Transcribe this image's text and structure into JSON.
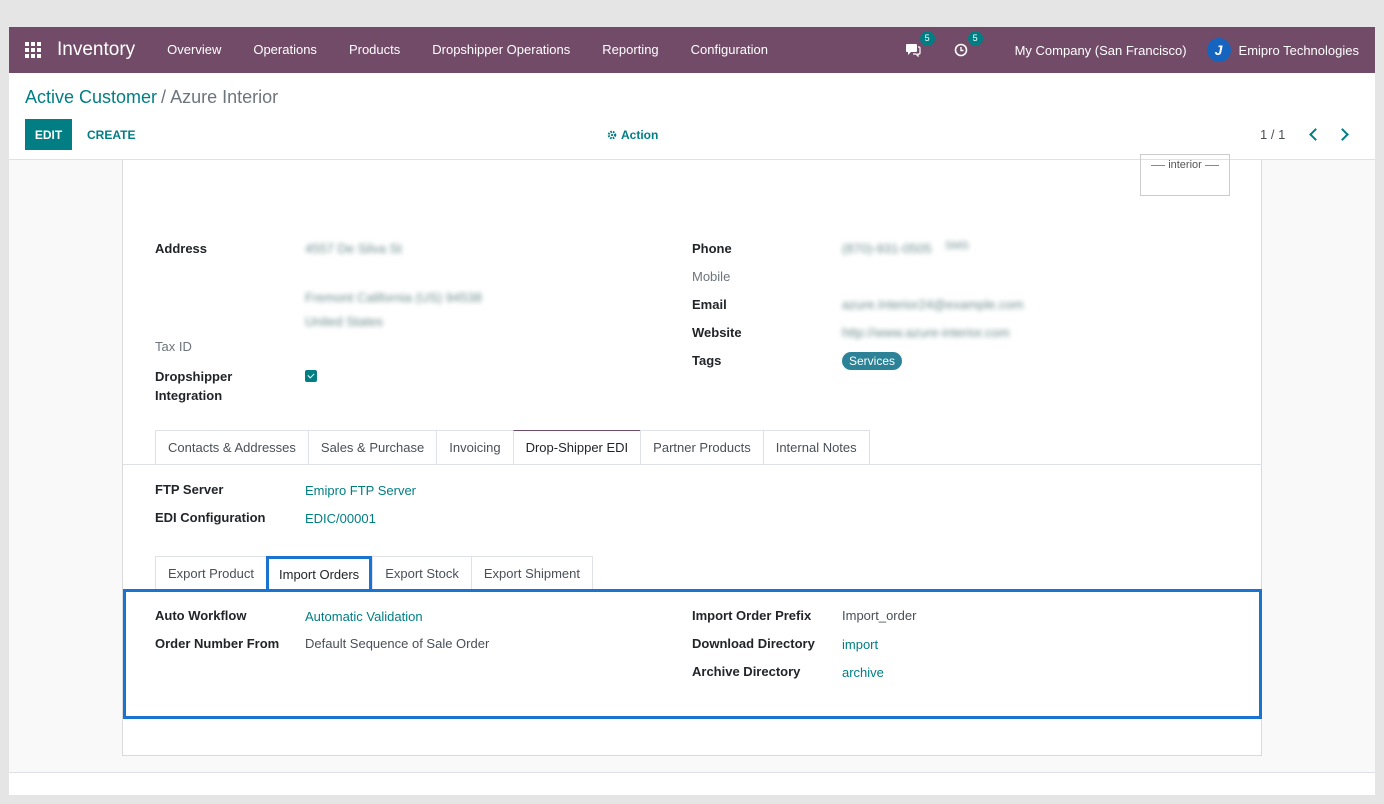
{
  "navbar": {
    "brand": "Inventory",
    "menu": [
      "Overview",
      "Operations",
      "Products",
      "Dropshipper Operations",
      "Reporting",
      "Configuration"
    ],
    "messages_count": "5",
    "activities_count": "5",
    "company": "My Company (San Francisco)",
    "user": "Emipro Technologies"
  },
  "control": {
    "breadcrumb_parent": "Active Customer",
    "breadcrumb_sep": "/",
    "breadcrumb_current": "Azure Interior",
    "edit_label": "EDIT",
    "create_label": "CREATE",
    "action_label": "Action",
    "pager": "1 / 1"
  },
  "partner": {
    "logo_text": "interior",
    "address_label": "Address",
    "street": "4557 De Silva St",
    "city_line": "Fremont  California (US)  94538",
    "country": "United States",
    "tax_id_label": "Tax ID",
    "dropshipper_label_1": "Dropshipper",
    "dropshipper_label_2": "Integration",
    "phone_label": "Phone",
    "phone": "(870)-931-0505",
    "sms": "SMS",
    "mobile_label": "Mobile",
    "email_label": "Email",
    "email": "azure.Interior24@example.com",
    "website_label": "Website",
    "website": "http://www.azure-interior.com",
    "tags_label": "Tags",
    "tag": "Services"
  },
  "main_tabs": [
    "Contacts & Addresses",
    "Sales & Purchase",
    "Invoicing",
    "Drop-Shipper EDI",
    "Partner Products",
    "Internal Notes"
  ],
  "edi": {
    "ftp_label": "FTP Server",
    "ftp_value": "Emipro FTP Server",
    "edi_label": "EDI Configuration",
    "edi_value": "EDIC/00001"
  },
  "sub_tabs": [
    "Export Product",
    "Import Orders",
    "Export Stock",
    "Export Shipment"
  ],
  "import_orders": {
    "auto_workflow_label": "Auto Workflow",
    "auto_workflow_value": "Automatic Validation",
    "order_number_label": "Order Number From",
    "order_number_value": "Default Sequence of Sale Order",
    "prefix_label": "Import Order Prefix",
    "prefix_value": "Import_order",
    "download_label": "Download Directory",
    "download_value": "import",
    "archive_label": "Archive Directory",
    "archive_value": "archive"
  }
}
